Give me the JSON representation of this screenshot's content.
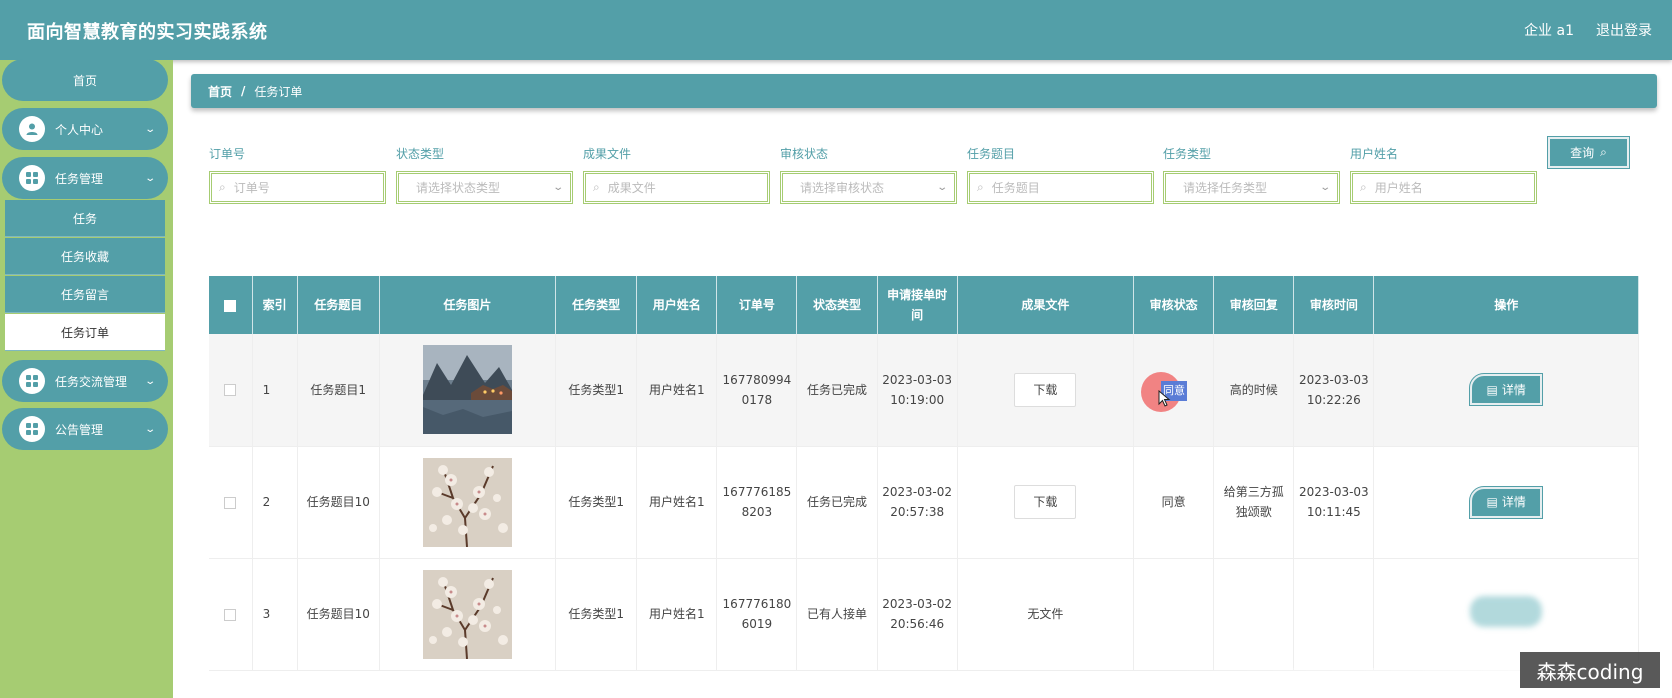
{
  "app": {
    "title": "面向智慧教育的实习实践系统"
  },
  "header": {
    "user": "企业 a1",
    "logout": "退出登录"
  },
  "sidebar": {
    "home": "首页",
    "items": [
      {
        "label": "个人中心",
        "icon": "user-icon"
      },
      {
        "label": "任务管理",
        "icon": "grid-icon"
      },
      {
        "label": "任务交流管理",
        "icon": "grid-icon"
      },
      {
        "label": "公告管理",
        "icon": "grid-icon"
      }
    ],
    "sub_items": [
      "任务",
      "任务收藏",
      "任务留言",
      "任务订单"
    ]
  },
  "breadcrumb": {
    "home": "首页",
    "separator": "/",
    "current": "任务订单"
  },
  "filters": [
    {
      "label": "订单号",
      "placeholder": "订单号",
      "type": "input"
    },
    {
      "label": "状态类型",
      "placeholder": "请选择状态类型",
      "type": "select"
    },
    {
      "label": "成果文件",
      "placeholder": "成果文件",
      "type": "input"
    },
    {
      "label": "审核状态",
      "placeholder": "请选择审核状态",
      "type": "select"
    },
    {
      "label": "任务题目",
      "placeholder": "任务题目",
      "type": "input"
    },
    {
      "label": "任务类型",
      "placeholder": "请选择任务类型",
      "type": "select"
    },
    {
      "label": "用户姓名",
      "placeholder": "用户姓名",
      "type": "input"
    }
  ],
  "query_button": "查询",
  "table": {
    "headers": [
      "索引",
      "任务题目",
      "任务图片",
      "任务类型",
      "用户姓名",
      "订单号",
      "状态类型",
      "申请接单时间",
      "成果文件",
      "审核状态",
      "审核回复",
      "审核时间",
      "操作"
    ],
    "rows": [
      {
        "index": "1",
        "title": "任务题目1",
        "image": "lake-village",
        "type": "任务类型1",
        "user": "用户姓名1",
        "order": "1677809940178",
        "status": "任务已完成",
        "apply_time": "2023-03-03 10:19:00",
        "file": "下载",
        "audit": "同意",
        "reply": "高的时候",
        "audit_time": "2023-03-03 10:22:26",
        "action": "详情"
      },
      {
        "index": "2",
        "title": "任务题目10",
        "image": "blossom-branch",
        "type": "任务类型1",
        "user": "用户姓名1",
        "order": "1677761858203",
        "status": "任务已完成",
        "apply_time": "2023-03-02 20:57:38",
        "file": "下载",
        "audit": "同意",
        "reply": "给第三方孤独颂歌",
        "audit_time": "2023-03-03 10:11:45",
        "action": "详情"
      },
      {
        "index": "3",
        "title": "任务题目10",
        "image": "blossom-branch",
        "type": "任务类型1",
        "user": "用户姓名1",
        "order": "1677761806019",
        "status": "已有人接单",
        "apply_time": "2023-03-02 20:56:46",
        "file": "无文件",
        "audit": "",
        "reply": "",
        "audit_time": "",
        "action": ""
      }
    ]
  },
  "watermark": "森森coding",
  "colors": {
    "primary": "#539fa8",
    "sidebar": "#a6cc72"
  }
}
